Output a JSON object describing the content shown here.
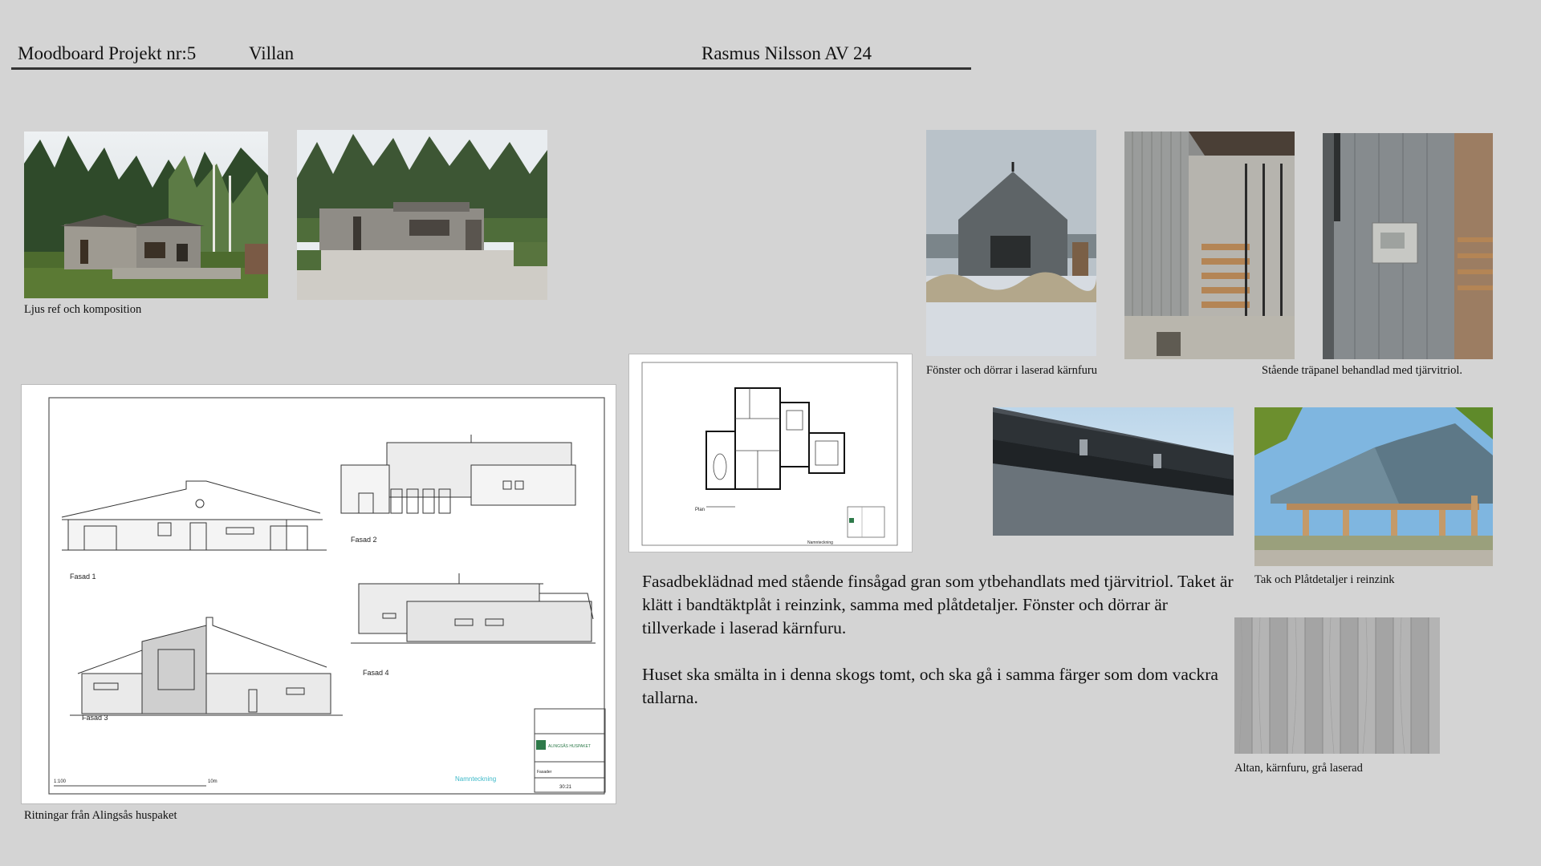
{
  "header": {
    "project": "Moodboard Projekt nr:5",
    "title": "Villan",
    "author": "Rasmus Nilsson AV 24"
  },
  "captions": {
    "light_ref": "Ljus ref  och komposition",
    "drawings": "Ritningar från Alingsås huspaket",
    "windows": "Fönster och dörrar i laserad kärnfuru",
    "panel": "Stående träpanel behandlad med tjärvitriol.",
    "roof": "Tak och Plåtdetaljer i reinzink",
    "deck": "Altan, kärnfuru, grå laserad"
  },
  "description": {
    "paragraph1": "Fasadbeklädnad med stående finsågad gran som ytbehandlats med tjärvitriol. Taket är klätt i bandtäktplåt i reinzink, samma med plåtdetaljer. Fönster och dörrar är tillverkade i laserad kärnfuru.",
    "paragraph2": "Huset ska smälta in i denna skogs tomt, och ska gå i samma färger som dom vackra tallarna."
  },
  "elevations": {
    "fasad1": "Fasad 1",
    "fasad2": "Fasad 2",
    "fasad3": "Fasad 3",
    "fasad4": "Fasad 4",
    "company": "ALINGSÅS HUSPAKET",
    "sheet_label": "Fasader",
    "sheet_number": "30:21",
    "scale": "1:100",
    "scale_end": "10m",
    "name_field": "Namnteckning"
  },
  "floorplan": {
    "plan_label": "Plan",
    "name_field": "Namnteckning"
  },
  "colors": {
    "background": "#d4d4d4",
    "text": "#111111",
    "rule": "#333333"
  }
}
